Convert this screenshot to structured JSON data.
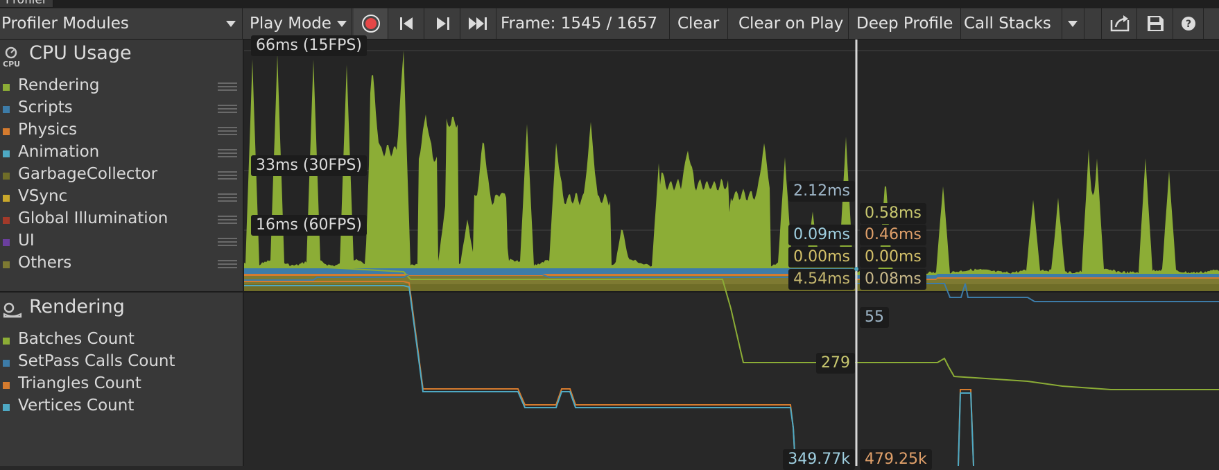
{
  "window": {
    "title": "Profiler"
  },
  "toolbar": {
    "modules_label": "Profiler Modules",
    "playmode_label": "Play Mode",
    "frame_label": "Frame: 1545 / 1657",
    "clear_label": "Clear",
    "clear_on_play_label": "Clear on Play",
    "deep_profile_label": "Deep Profile",
    "call_stacks_label": "Call Stacks",
    "icons": [
      "record-icon",
      "prev-frame-icon",
      "next-frame-icon",
      "last-frame-icon",
      "load-icon",
      "save-icon",
      "help-icon"
    ]
  },
  "cpu_module": {
    "title": "CPU Usage",
    "icon": "CPU",
    "items": [
      {
        "label": "Rendering",
        "color": "#8cad36"
      },
      {
        "label": "Scripts",
        "color": "#3d7ca8"
      },
      {
        "label": "Physics",
        "color": "#d57b2e"
      },
      {
        "label": "Animation",
        "color": "#4ea9c4"
      },
      {
        "label": "GarbageCollector",
        "color": "#6f6d28"
      },
      {
        "label": "VSync",
        "color": "#c9a82b"
      },
      {
        "label": "Global Illumination",
        "color": "#a33a2a"
      },
      {
        "label": "UI",
        "color": "#6b3f9e"
      },
      {
        "label": "Others",
        "color": "#7e7a32"
      }
    ],
    "fps_lines": [
      "66ms (15FPS)",
      "33ms (30FPS)",
      "16ms (60FPS)"
    ],
    "values_left": [
      "2.12ms",
      "0.09ms",
      "0.00ms",
      "4.54ms"
    ],
    "values_right": [
      "0.58ms",
      "0.46ms",
      "0.00ms",
      "0.08ms"
    ]
  },
  "rendering_module": {
    "title": "Rendering",
    "items": [
      {
        "label": "Batches Count",
        "color": "#8cad36"
      },
      {
        "label": "SetPass Calls Count",
        "color": "#3d7ca8"
      },
      {
        "label": "Triangles Count",
        "color": "#d57b2e"
      },
      {
        "label": "Vertices Count",
        "color": "#4ea9c4"
      }
    ],
    "values": [
      "55",
      "279",
      "349.77k",
      "479.25k"
    ]
  }
}
